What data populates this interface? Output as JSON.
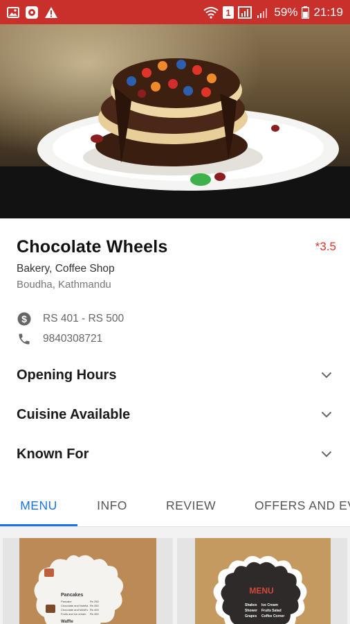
{
  "status_bar": {
    "battery": "59%",
    "time": "21:19",
    "notification_badge": "1",
    "icons": [
      "image-icon",
      "app-notification-icon",
      "warning-icon",
      "wifi-icon",
      "sim-icon",
      "signal-icon",
      "battery-icon"
    ]
  },
  "restaurant": {
    "name": "Chocolate Wheels",
    "rating": "*3.5",
    "category": "Bakery, Coffee Shop",
    "location": "Boudha, Kathmandu",
    "price_range": "RS 401 - RS 500",
    "phone": "9840308721"
  },
  "sections": [
    {
      "label": "Opening Hours"
    },
    {
      "label": "Cuisine Available"
    },
    {
      "label": "Known For"
    }
  ],
  "tabs": [
    {
      "label": "MENU",
      "active": true
    },
    {
      "label": "INFO",
      "active": false
    },
    {
      "label": "REVIEW",
      "active": false
    },
    {
      "label": "OFFERS AND EVENTS",
      "active": false
    }
  ],
  "menu_cards": [
    {
      "heading": "Pancakes",
      "section2": "Waffle",
      "items": [
        "Pancake",
        "Chocolate and Nutella",
        "Chocolate and M&M's",
        "Fruits and Ice cream"
      ],
      "prices": [
        "Rs 250",
        "Rs 350",
        "Rs 400",
        "Rs 450"
      ]
    },
    {
      "heading": "MENU",
      "col1": [
        "Shakes",
        "Shower",
        "Grapes"
      ],
      "col2": [
        "Ice Cream",
        "Fruits Salad",
        "Coffee Corner"
      ]
    }
  ],
  "colors": {
    "status_bar": "#c8302c",
    "accent": "#1a73e8",
    "rating": "#e0332c"
  }
}
